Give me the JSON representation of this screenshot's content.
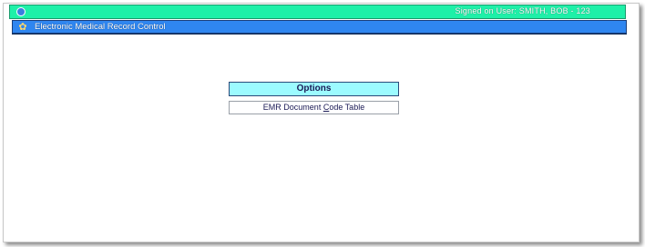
{
  "topbar": {
    "home_icon": "home-icon",
    "signed_in_text": "Signed on User: SMITH, BOB - 123"
  },
  "titlebar": {
    "icon": "gear-icon",
    "title": "Electronic Medical Record Control"
  },
  "options": {
    "header": "Options",
    "items": [
      {
        "label_before": "EMR Document ",
        "hotkey": "C",
        "label_after": "ode Table"
      }
    ]
  },
  "colors": {
    "topbar_bg": "#1ef0a8",
    "titlebar_bg": "#2f86f0",
    "options_header_bg": "#9cfbff"
  }
}
